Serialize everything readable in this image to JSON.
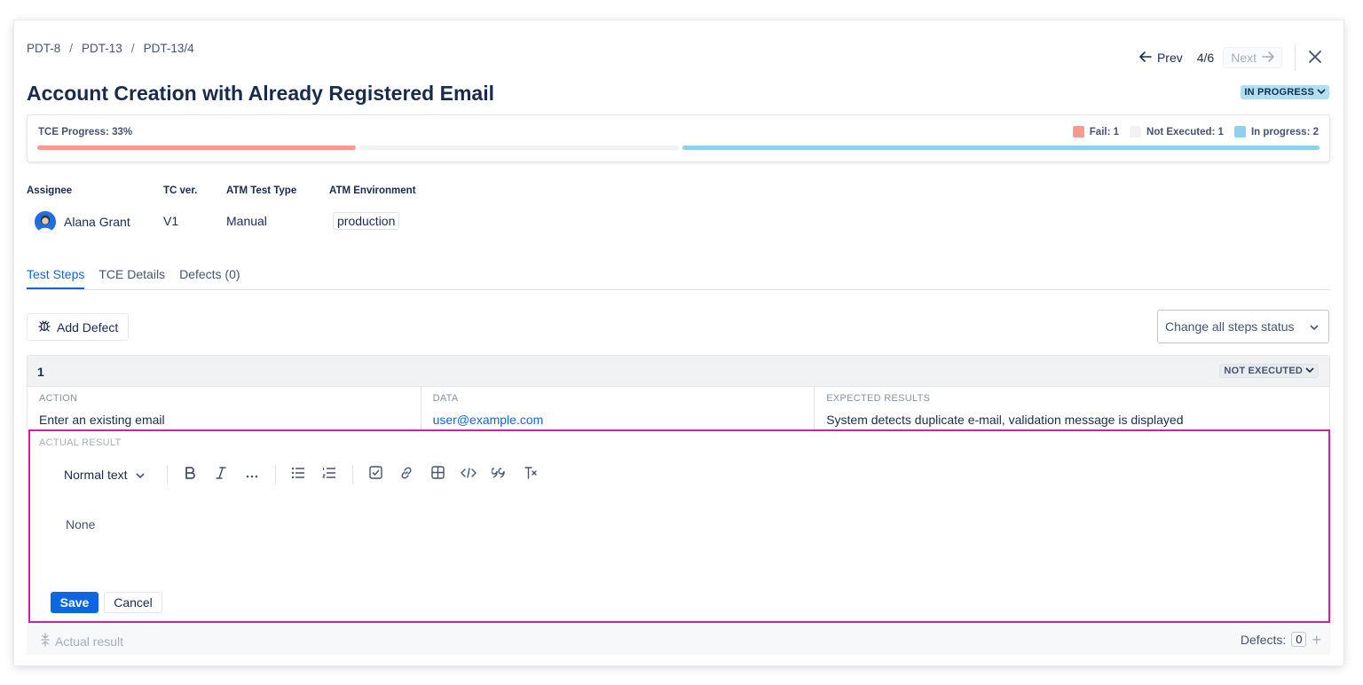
{
  "breadcrumb": [
    "PDT-8",
    "PDT-13",
    "PDT-13/4"
  ],
  "breadcrumb_sep": "/",
  "nav": {
    "prev": "Prev",
    "counter": "4/6",
    "next": "Next"
  },
  "title": "Account Creation with Already Registered Email",
  "status": "IN PROGRESS",
  "progress": {
    "label": "TCE Progress: 33%",
    "legend": {
      "fail": "Fail: 1",
      "not_executed": "Not Executed: 1",
      "in_progress": "In progress: 2"
    },
    "segments": {
      "fail": 1,
      "not_executed": 1,
      "in_progress": 2
    },
    "colors": {
      "fail": "#f79a8f",
      "not_executed": "#f1f2f4",
      "in_progress": "#8fd0ee"
    }
  },
  "fields": {
    "assignee_label": "Assignee",
    "assignee": "Alana Grant",
    "tc_ver_label": "TC ver.",
    "tc_ver": "V1",
    "test_type_label": "ATM Test Type",
    "test_type": "Manual",
    "environment_label": "ATM Environment",
    "environment": "production"
  },
  "tabs": [
    "Test Steps",
    "TCE Details",
    "Defects (0)"
  ],
  "add_defect": "Add Defect",
  "change_status": "Change all steps status",
  "step": {
    "number": "1",
    "status": "NOT EXECUTED",
    "action_label": "ACTION",
    "action": "Enter an existing email",
    "data_label": "DATA",
    "data": "user@example.com",
    "expected_label": "EXPECTED RESULTS",
    "expected": "System detects duplicate e-mail, validation message is displayed"
  },
  "editor": {
    "label": "ACTUAL RESULT",
    "text_style": "Normal text",
    "content": "None",
    "save": "Save",
    "cancel": "Cancel",
    "toolbar_icons": [
      "bold-icon",
      "italic-icon",
      "more-icon",
      "bullet-list-icon",
      "numbered-list-icon",
      "checkbox-icon",
      "link-icon",
      "table-icon",
      "code-icon",
      "quote-icon",
      "clear-format-icon"
    ]
  },
  "footer": {
    "actual_result": "Actual result",
    "defects_label": "Defects:",
    "defects_count": "0"
  },
  "accent_color": "#0c66e4",
  "highlight_color": "#d21ea6"
}
